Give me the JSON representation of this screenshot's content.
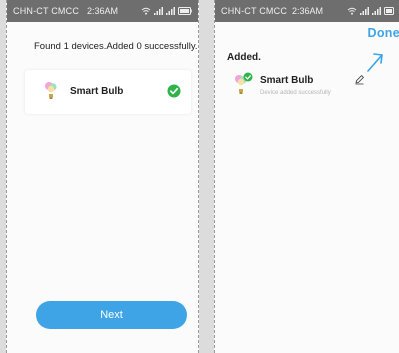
{
  "status_bar": {
    "carrier": "CHN-CT CMCC",
    "time": "2:36AM",
    "icons": [
      "wifi-icon",
      "signal-icon",
      "signal-icon",
      "battery-icon"
    ]
  },
  "left_screen": {
    "title": "Found 1 devices.Added 0 successfully.",
    "device": {
      "name": "Smart Bulb",
      "icon": "bulb-icon",
      "state_icon": "check-circle-icon"
    },
    "next_label": "Next"
  },
  "right_screen": {
    "done_label": "Done",
    "title": "Added.",
    "device": {
      "name": "Smart Bulb",
      "status": "Device added successfully",
      "icon": "bulb-icon",
      "edit_icon": "pencil-icon"
    },
    "annotation_icon": "arrow-icon"
  },
  "colors": {
    "accent": "#3ea4e6",
    "success": "#2fb34a",
    "status_bar": "#6e6e6e"
  }
}
